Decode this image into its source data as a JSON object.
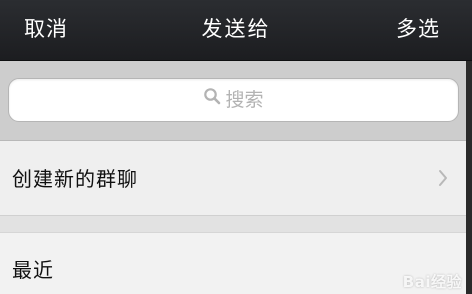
{
  "navbar": {
    "cancel_label": "取消",
    "title": "发送给",
    "multi_select_label": "多选"
  },
  "search": {
    "placeholder": "搜索",
    "icon": "search-icon"
  },
  "create_group": {
    "label": "创建新的群聊",
    "icon": "chevron-right-icon"
  },
  "recent": {
    "label": "最近"
  },
  "watermark": {
    "text": "Bai经验"
  },
  "colors": {
    "navbar_bg": "#1f2024",
    "navbar_text": "#ffffff",
    "search_band_bg": "#cdcdcd",
    "list_bg": "#efefef",
    "placeholder": "#b3b3b3"
  }
}
